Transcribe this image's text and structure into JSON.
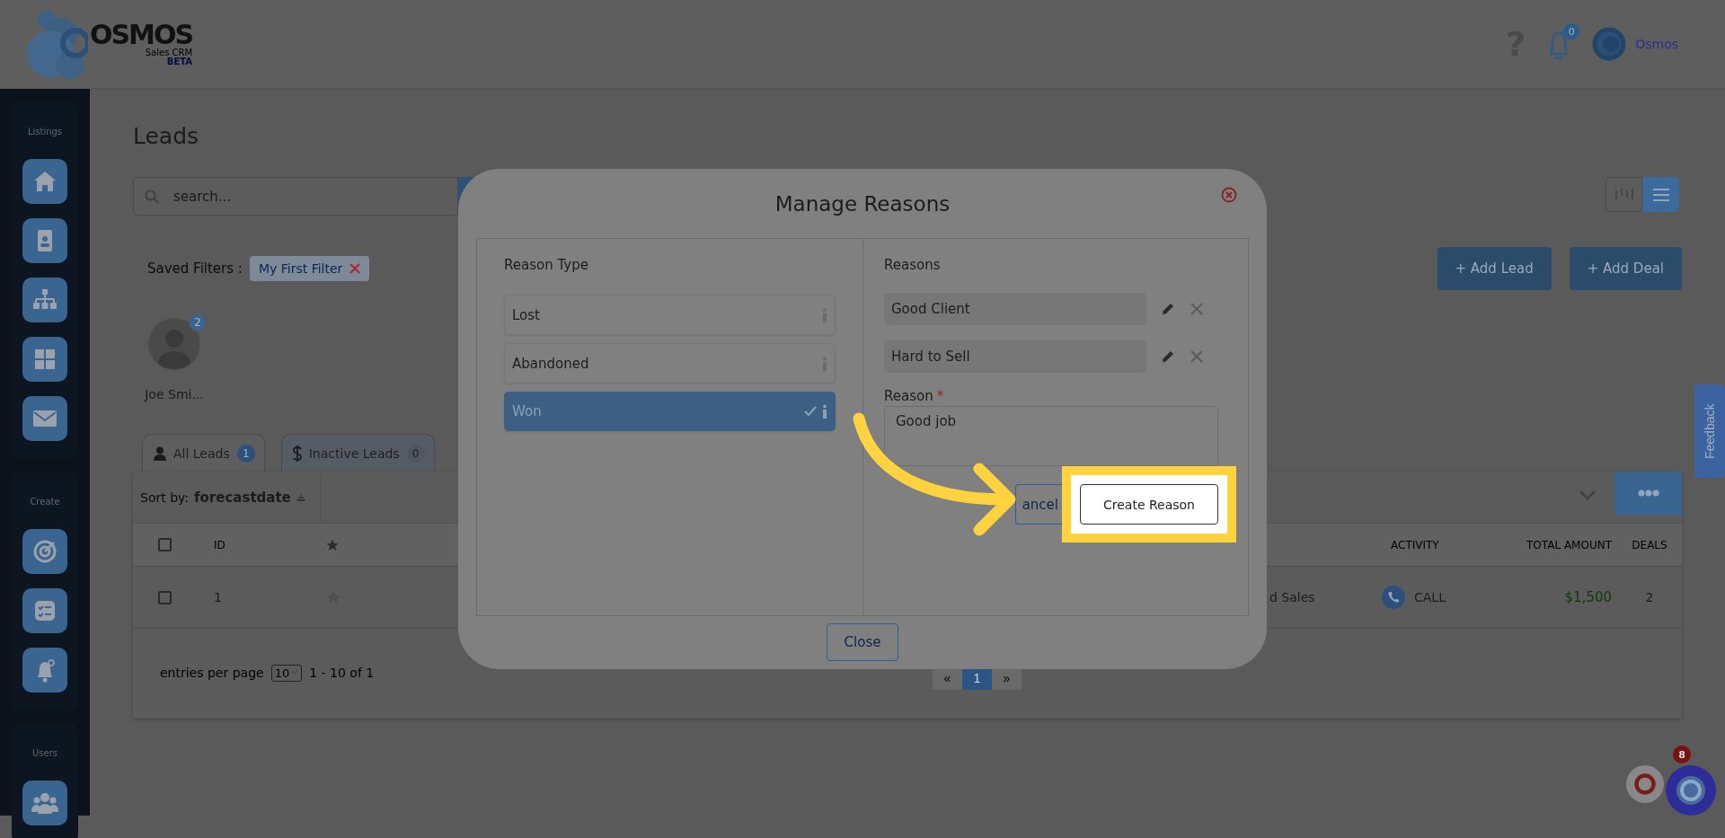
{
  "header": {
    "logo": {
      "name": "OSMOS",
      "subtitle": "Sales CRM",
      "tag": "BETA"
    },
    "help": "?",
    "notifications": {
      "count": "0"
    },
    "user": {
      "name": "Osmos"
    }
  },
  "sidebar": {
    "sections": [
      {
        "label": "Listings",
        "items": [
          {
            "kind": "home"
          },
          {
            "kind": "contact"
          },
          {
            "kind": "org"
          },
          {
            "kind": "grid"
          },
          {
            "kind": "mail"
          }
        ]
      },
      {
        "label": "Create",
        "items": [
          {
            "kind": "target"
          },
          {
            "kind": "tasks"
          },
          {
            "kind": "bell"
          }
        ]
      },
      {
        "label": "Users",
        "items": [
          {
            "kind": "users"
          }
        ]
      }
    ]
  },
  "page": {
    "title": "Leads",
    "search": {
      "placeholder": "search..."
    },
    "view_toggle": [
      {
        "kind": "kanban",
        "selected": false
      },
      {
        "kind": "list",
        "selected": true
      }
    ],
    "saved_filters": {
      "label": "Saved Filters :",
      "filters": [
        "My First Filter"
      ]
    },
    "actions": [
      "+ Add Lead",
      "+ Add Deal"
    ],
    "users": [
      {
        "name": "Joe Smi...",
        "count": "2"
      }
    ],
    "tabs": [
      {
        "kind": "person",
        "label": "All Leads",
        "count": "1",
        "selected": true
      },
      {
        "kind": "dollar",
        "label": "Inactive Leads",
        "count": "0",
        "selected": false
      }
    ]
  },
  "table": {
    "sort": {
      "label": "Sort by:",
      "field": "forecastdate"
    },
    "columns": [
      {
        "kind": "checkbox",
        "checked": false
      },
      {
        "kind": "text",
        "label": "ID"
      },
      {
        "kind": "star"
      },
      {
        "kind": "text",
        "label": "ACTIVITY"
      },
      {
        "kind": "text",
        "label": "TOTAL AMOUNT"
      },
      {
        "kind": "text",
        "label": "DEALS"
      }
    ],
    "rows": [
      {
        "checked": false,
        "id": "1",
        "column_4": "d Sales",
        "activity": "CALL",
        "total_amount": "$1,500",
        "deals": "2"
      }
    ],
    "pagination": {
      "per_page_label": "entries per page",
      "per_page": "10",
      "range": "1 - 10 of 1",
      "pages": [
        {
          "label": "«",
          "selected": false
        },
        {
          "label": "1",
          "selected": true
        },
        {
          "label": "»",
          "selected": false
        }
      ]
    }
  },
  "modal": {
    "title": "Manage Reasons",
    "reason_type": {
      "heading": "Reason Type",
      "types": [
        {
          "label": "Lost",
          "selected": false
        },
        {
          "label": "Abandoned",
          "selected": false
        },
        {
          "label": "Won",
          "selected": true
        }
      ]
    },
    "reasons": {
      "heading": "Reasons",
      "items": [
        "Good Client",
        "Hard to Sell"
      ],
      "field": {
        "label": "Reason",
        "required_mark": "*",
        "value": "Good job"
      },
      "buttons": [
        {
          "kind": "cancel",
          "label": "ancel"
        },
        {
          "kind": "create",
          "label": "Create Reason",
          "highlighted": true
        }
      ]
    },
    "close": "Close"
  },
  "feedback": {
    "label": "Feedback"
  },
  "chat": {
    "badge": "8"
  }
}
